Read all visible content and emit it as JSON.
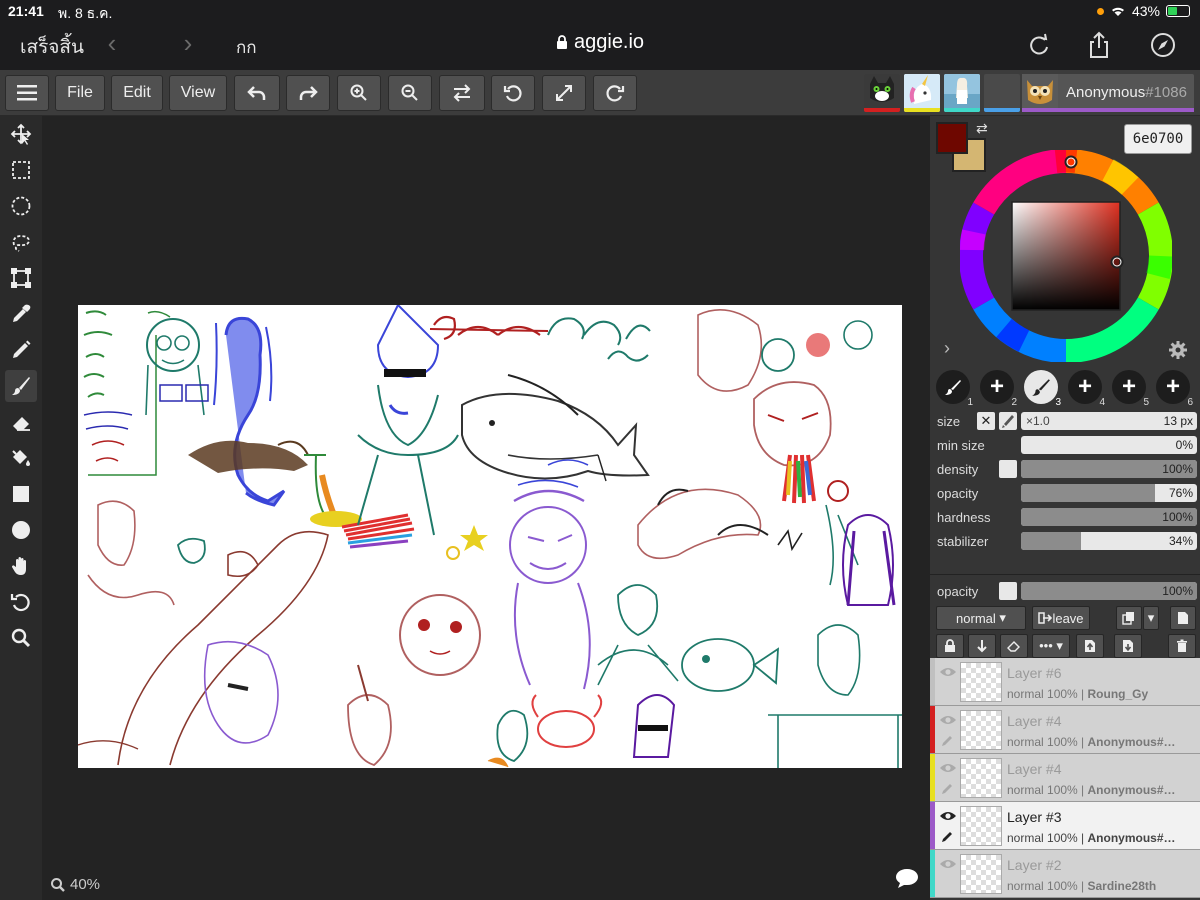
{
  "status_bar": {
    "time": "21:41",
    "date": "พ. 8 ธ.ค.",
    "battery": "43%"
  },
  "browser": {
    "done_label": "เสร็จสิ้น",
    "text_size": "กก",
    "url": "aggie.io"
  },
  "toolbar": {
    "file_label": "File",
    "edit_label": "Edit",
    "view_label": "View",
    "user_name": "Anonymous",
    "user_number": "#1086"
  },
  "colors": {
    "primary": "#6e0700",
    "secondary": "#d4b672",
    "user_bar": "#9c5ac8",
    "accent": "#e03020"
  },
  "color_picker": {
    "hex_value": "6e0700"
  },
  "brushes": [
    {
      "n": "1",
      "icon": "brush-icon"
    },
    {
      "n": "2",
      "icon": "plus-icon"
    },
    {
      "n": "3",
      "icon": "brush-icon",
      "selected": true
    },
    {
      "n": "4",
      "icon": "plus-icon"
    },
    {
      "n": "5",
      "icon": "plus-icon"
    },
    {
      "n": "6",
      "icon": "plus-icon"
    }
  ],
  "brush_settings": {
    "size": {
      "label": "size",
      "multiplier": "×1.0",
      "value": "13 px"
    },
    "min_size": {
      "label": "min size",
      "value": "0%",
      "percent": 0
    },
    "density": {
      "label": "density",
      "value": "100%",
      "percent": 100
    },
    "opacity": {
      "label": "opacity",
      "value": "76%",
      "percent": 76
    },
    "hardness": {
      "label": "hardness",
      "value": "100%",
      "percent": 100
    },
    "stabilizer": {
      "label": "stabilizer",
      "value": "34%",
      "percent": 34
    }
  },
  "layer_settings": {
    "opacity_label": "opacity",
    "opacity_value": "100%",
    "blend_mode": "normal",
    "leave_label": "leave"
  },
  "layers": [
    {
      "name": "Layer #6",
      "meta": "normal 100% |",
      "owner": "Roung_Gy",
      "color": "#c0c0c0"
    },
    {
      "name": "Layer #4",
      "meta": "normal 100% |",
      "owner": "Anonymous#…",
      "color": "#d42020"
    },
    {
      "name": "Layer #4",
      "meta": "normal 100% |",
      "owner": "Anonymous#…",
      "color": "#e8e020"
    },
    {
      "name": "Layer #3",
      "meta": "normal 100% |",
      "owner": "Anonymous#…",
      "color": "#9c5ac8",
      "active": true
    },
    {
      "name": "Layer #2",
      "meta": "normal 100% |",
      "owner": "Sardine28th",
      "color": "#40d8c8"
    }
  ],
  "canvas": {
    "zoom": "40%"
  }
}
